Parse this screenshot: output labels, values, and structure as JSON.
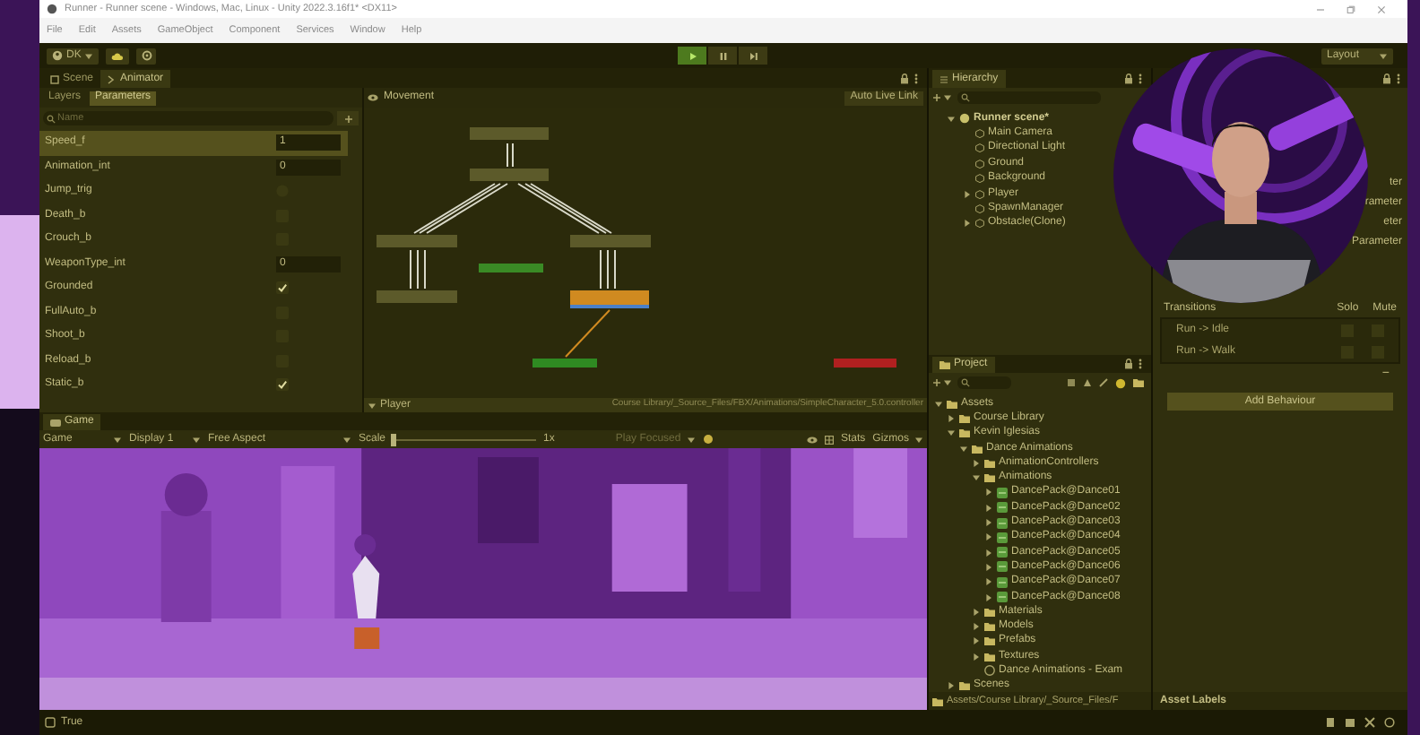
{
  "window": {
    "title": "Runner - Runner scene - Windows, Mac, Linux - Unity 2022.3.16f1* <DX11>"
  },
  "menu": [
    "File",
    "Edit",
    "Assets",
    "GameObject",
    "Component",
    "Services",
    "Window",
    "Help"
  ],
  "toolbar": {
    "account": "DK",
    "playing": true,
    "layout": "Layout"
  },
  "animator": {
    "tabs": [
      {
        "label": "Scene",
        "selected": false
      },
      {
        "label": "Animator",
        "selected": true
      }
    ],
    "sub_tabs": [
      {
        "label": "Layers",
        "selected": false
      },
      {
        "label": "Parameters",
        "selected": true
      }
    ],
    "search": {
      "placeholder": "Name"
    },
    "parameters": [
      {
        "name": "Speed_f",
        "kind": "value",
        "value": "1",
        "selected": true
      },
      {
        "name": "Animation_int",
        "kind": "value",
        "value": "0",
        "selected": false
      },
      {
        "name": "Jump_trig",
        "kind": "trigger",
        "selected": false
      },
      {
        "name": "Death_b",
        "kind": "bool",
        "checked": false,
        "selected": false
      },
      {
        "name": "Crouch_b",
        "kind": "bool",
        "checked": false,
        "selected": false
      },
      {
        "name": "WeaponType_int",
        "kind": "value",
        "value": "0",
        "selected": false
      },
      {
        "name": "Grounded",
        "kind": "bool",
        "checked": true,
        "selected": false
      },
      {
        "name": "FullAuto_b",
        "kind": "bool",
        "checked": false,
        "selected": false
      },
      {
        "name": "Shoot_b",
        "kind": "bool",
        "checked": false,
        "selected": false
      },
      {
        "name": "Reload_b",
        "kind": "bool",
        "checked": false,
        "selected": false
      },
      {
        "name": "Static_b",
        "kind": "bool",
        "checked": true,
        "selected": false
      }
    ],
    "graph": {
      "layer": "Movement",
      "live_link": "Auto Live Link",
      "states": [
        {
          "color": "#5c5a2a",
          "active": false
        },
        {
          "color": "#5c5a2a",
          "active": false
        },
        {
          "color": "#5c5a2a",
          "active": false
        },
        {
          "color": "#5c5a2a",
          "active": false
        },
        {
          "color": "#5c5a2a",
          "active": false
        },
        {
          "color": "#3a8a25",
          "active": false
        },
        {
          "color": "#d08a20",
          "active": true
        },
        {
          "color": "#2f8a22",
          "active": false
        },
        {
          "color": "#b02020",
          "active": false
        }
      ]
    },
    "breadcrumb": "Player",
    "path": "Course Library/_Source_Files/FBX/Animations/SimpleCharacter_5.0.controller"
  },
  "game": {
    "tab": "Game",
    "view": "Game",
    "display": "Display 1",
    "aspect": "Free Aspect",
    "scale_label": "Scale",
    "scale": {
      "level": 0.0
    },
    "scale_value": "1x",
    "play_mode": "Play Focused",
    "stats": "Stats",
    "gizmos": "Gizmos"
  },
  "hierarchy": {
    "title": "Hierarchy",
    "scene": "Runner scene*",
    "objects": [
      {
        "name": "Main Camera"
      },
      {
        "name": "Directional Light"
      },
      {
        "name": "Ground"
      },
      {
        "name": "Background"
      },
      {
        "name": "Player",
        "expanded": false
      },
      {
        "name": "SpawnManager"
      },
      {
        "name": "Obstacle(Clone)",
        "expanded": false
      }
    ]
  },
  "project": {
    "title": "Project",
    "tree": [
      {
        "name": "Assets",
        "kind": "folder",
        "expanded": true,
        "children": [
          {
            "name": "Course Library",
            "kind": "folder",
            "expanded": false
          },
          {
            "name": "Kevin Iglesias",
            "kind": "folder",
            "expanded": true,
            "children": [
              {
                "name": "Dance Animations",
                "kind": "folder",
                "expanded": true,
                "children": [
                  {
                    "name": "AnimationControllers",
                    "kind": "folder",
                    "expanded": false
                  },
                  {
                    "name": "Animations",
                    "kind": "folder",
                    "expanded": true,
                    "children": [
                      {
                        "name": "DancePack@Dance01",
                        "kind": "model",
                        "expanded": false
                      },
                      {
                        "name": "DancePack@Dance02",
                        "kind": "model",
                        "expanded": false
                      },
                      {
                        "name": "DancePack@Dance03",
                        "kind": "model",
                        "expanded": false
                      },
                      {
                        "name": "DancePack@Dance04",
                        "kind": "model",
                        "expanded": false
                      },
                      {
                        "name": "DancePack@Dance05",
                        "kind": "model",
                        "expanded": false
                      },
                      {
                        "name": "DancePack@Dance06",
                        "kind": "model",
                        "expanded": false
                      },
                      {
                        "name": "DancePack@Dance07",
                        "kind": "model",
                        "expanded": false
                      },
                      {
                        "name": "DancePack@Dance08",
                        "kind": "model",
                        "expanded": false
                      }
                    ]
                  },
                  {
                    "name": "Materials",
                    "kind": "folder",
                    "expanded": false
                  },
                  {
                    "name": "Models",
                    "kind": "folder",
                    "expanded": false
                  },
                  {
                    "name": "Prefabs",
                    "kind": "folder",
                    "expanded": false
                  },
                  {
                    "name": "Textures",
                    "kind": "folder",
                    "expanded": false
                  },
                  {
                    "name": "Dance Animations - Exam",
                    "kind": "scene"
                  }
                ]
              }
            ]
          },
          {
            "name": "Scenes",
            "kind": "folder",
            "expanded": false
          }
        ]
      }
    ],
    "path": "Assets/Course Library/_Source_Files/F"
  },
  "inspector": {
    "fragments": [
      "ter",
      "rameter",
      "eter",
      "Parameter"
    ],
    "transitions_header": "Transitions",
    "solo": "Solo",
    "mute": "Mute",
    "transitions": [
      {
        "name": "Run -> Idle",
        "solo": false,
        "mute": false
      },
      {
        "name": "Run -> Walk",
        "solo": false,
        "mute": false
      }
    ],
    "remove": "−",
    "add_behaviour": "Add Behaviour",
    "asset_labels": "Asset Labels"
  },
  "status_bar": {
    "message": "True"
  }
}
